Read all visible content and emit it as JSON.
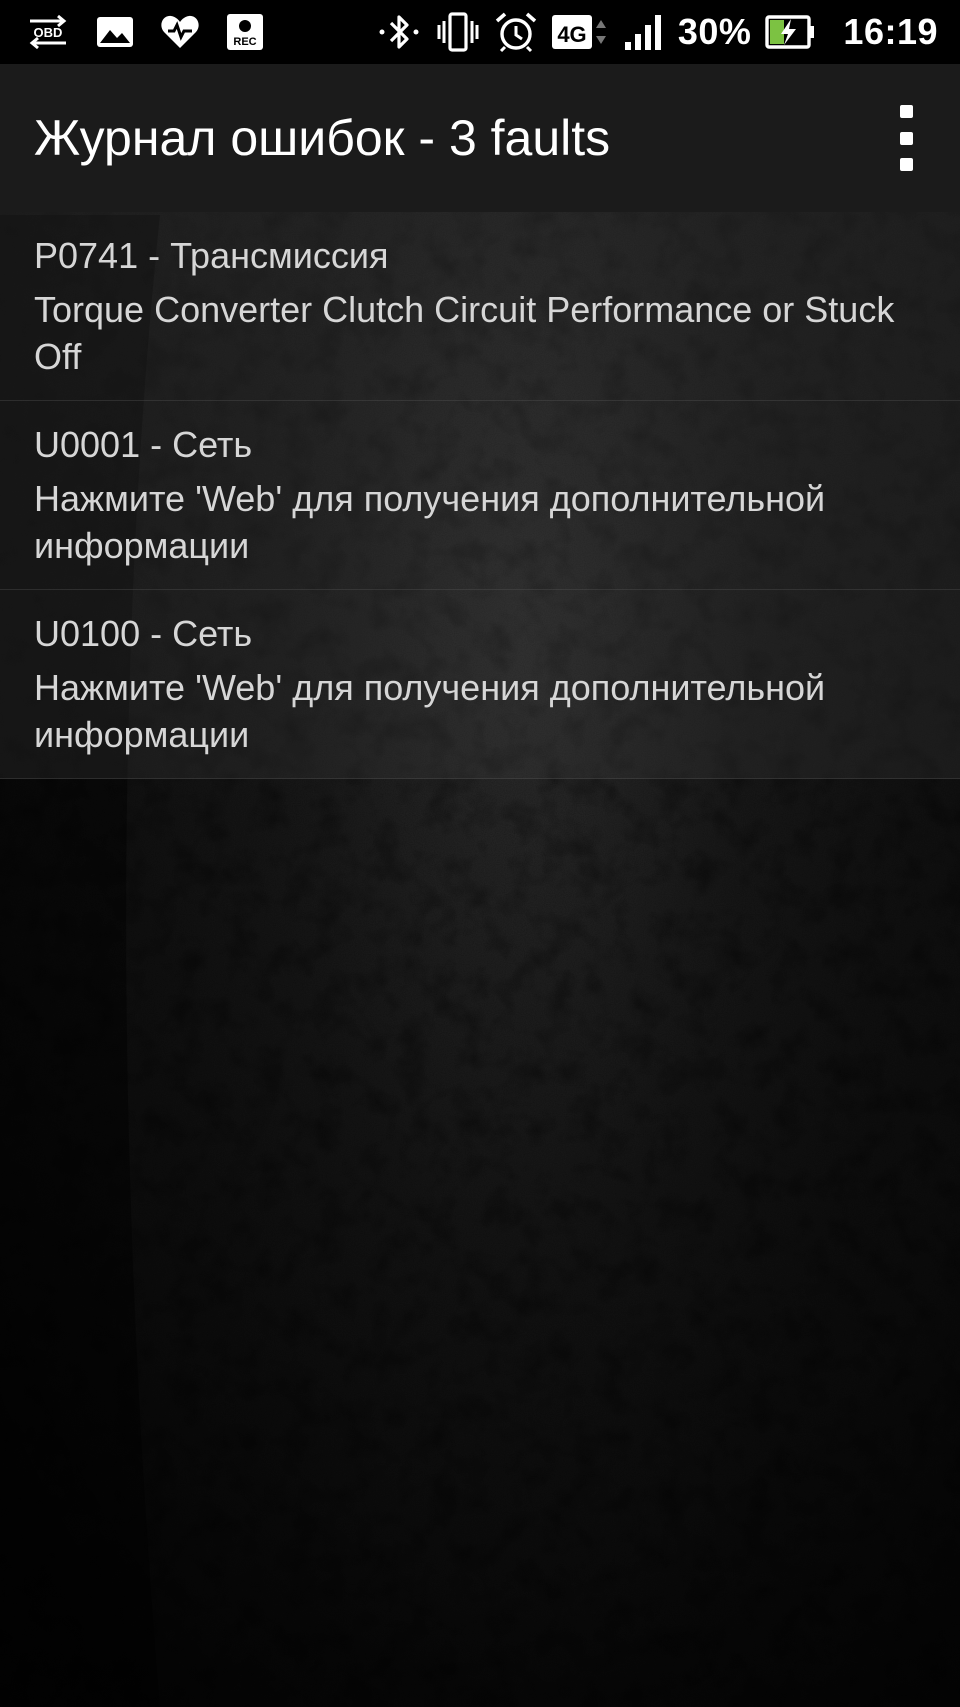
{
  "status_bar": {
    "left_icons": [
      "obd-icon",
      "image-icon",
      "heart-icon",
      "rec-icon"
    ],
    "obd_label": "OBD",
    "rec_label": "REC",
    "network_label": "4G",
    "battery_percent": "30%",
    "time": "16:19"
  },
  "app_bar": {
    "title": "Журнал ошибок - 3 faults"
  },
  "faults": [
    {
      "code": "P0741 - Трансмиссия",
      "description": "Torque Converter Clutch Circuit Performance or Stuck Off"
    },
    {
      "code": "U0001 - Сеть",
      "description": "Нажмите 'Web' для получения дополнительной информации"
    },
    {
      "code": "U0100 - Сеть",
      "description": "Нажмите 'Web' для получения дополнительной информации"
    }
  ],
  "colors": {
    "status_bar_bg": "#000000",
    "app_bar_bg": "#1b1b1b",
    "text_primary": "#ffffff",
    "text_secondary": "#d6d6d6",
    "battery_charge": "#7cc242"
  }
}
